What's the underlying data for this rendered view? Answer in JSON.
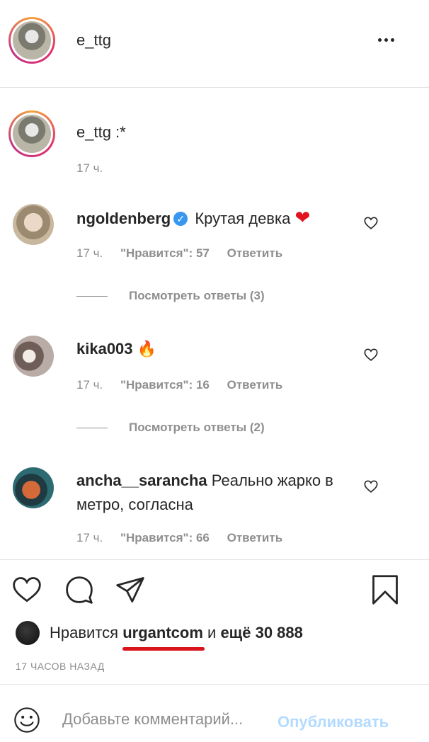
{
  "header": {
    "username": "e_ttg"
  },
  "caption": {
    "text": "e_ttg :*",
    "time": "17 ч."
  },
  "comments": [
    {
      "user": "ngoldenberg",
      "verified": true,
      "text": "Крутая девка",
      "emoji": "heart",
      "time": "17 ч.",
      "likes": "\"Нравится\": 57",
      "reply": "Ответить",
      "replies": "Посмотреть ответы (3)"
    },
    {
      "user": "kika003",
      "verified": false,
      "text": "",
      "emoji": "fire",
      "time": "17 ч.",
      "likes": "\"Нравится\": 16",
      "reply": "Ответить",
      "replies": "Посмотреть ответы (2)"
    },
    {
      "user": "ancha__sarancha",
      "verified": false,
      "text": "Реально жарко в метро, согласна",
      "emoji": "",
      "time": "17 ч.",
      "likes": "\"Нравится\": 66",
      "reply": "Ответить"
    }
  ],
  "actions": {
    "likes_prefix": "Нравится",
    "liker": "urgantcom",
    "likes_middle": "и",
    "likes_count": "ещё 30 888",
    "timestamp": "17 ЧАСОВ НАЗАД"
  },
  "add_comment": {
    "placeholder": "Добавьте комментарий...",
    "post_label": "Опубликовать"
  },
  "colors": {
    "accent_link": "#b3dbff",
    "underline": "#d9141b",
    "verified": "#3897f0",
    "muted": "#8e8e8e"
  }
}
